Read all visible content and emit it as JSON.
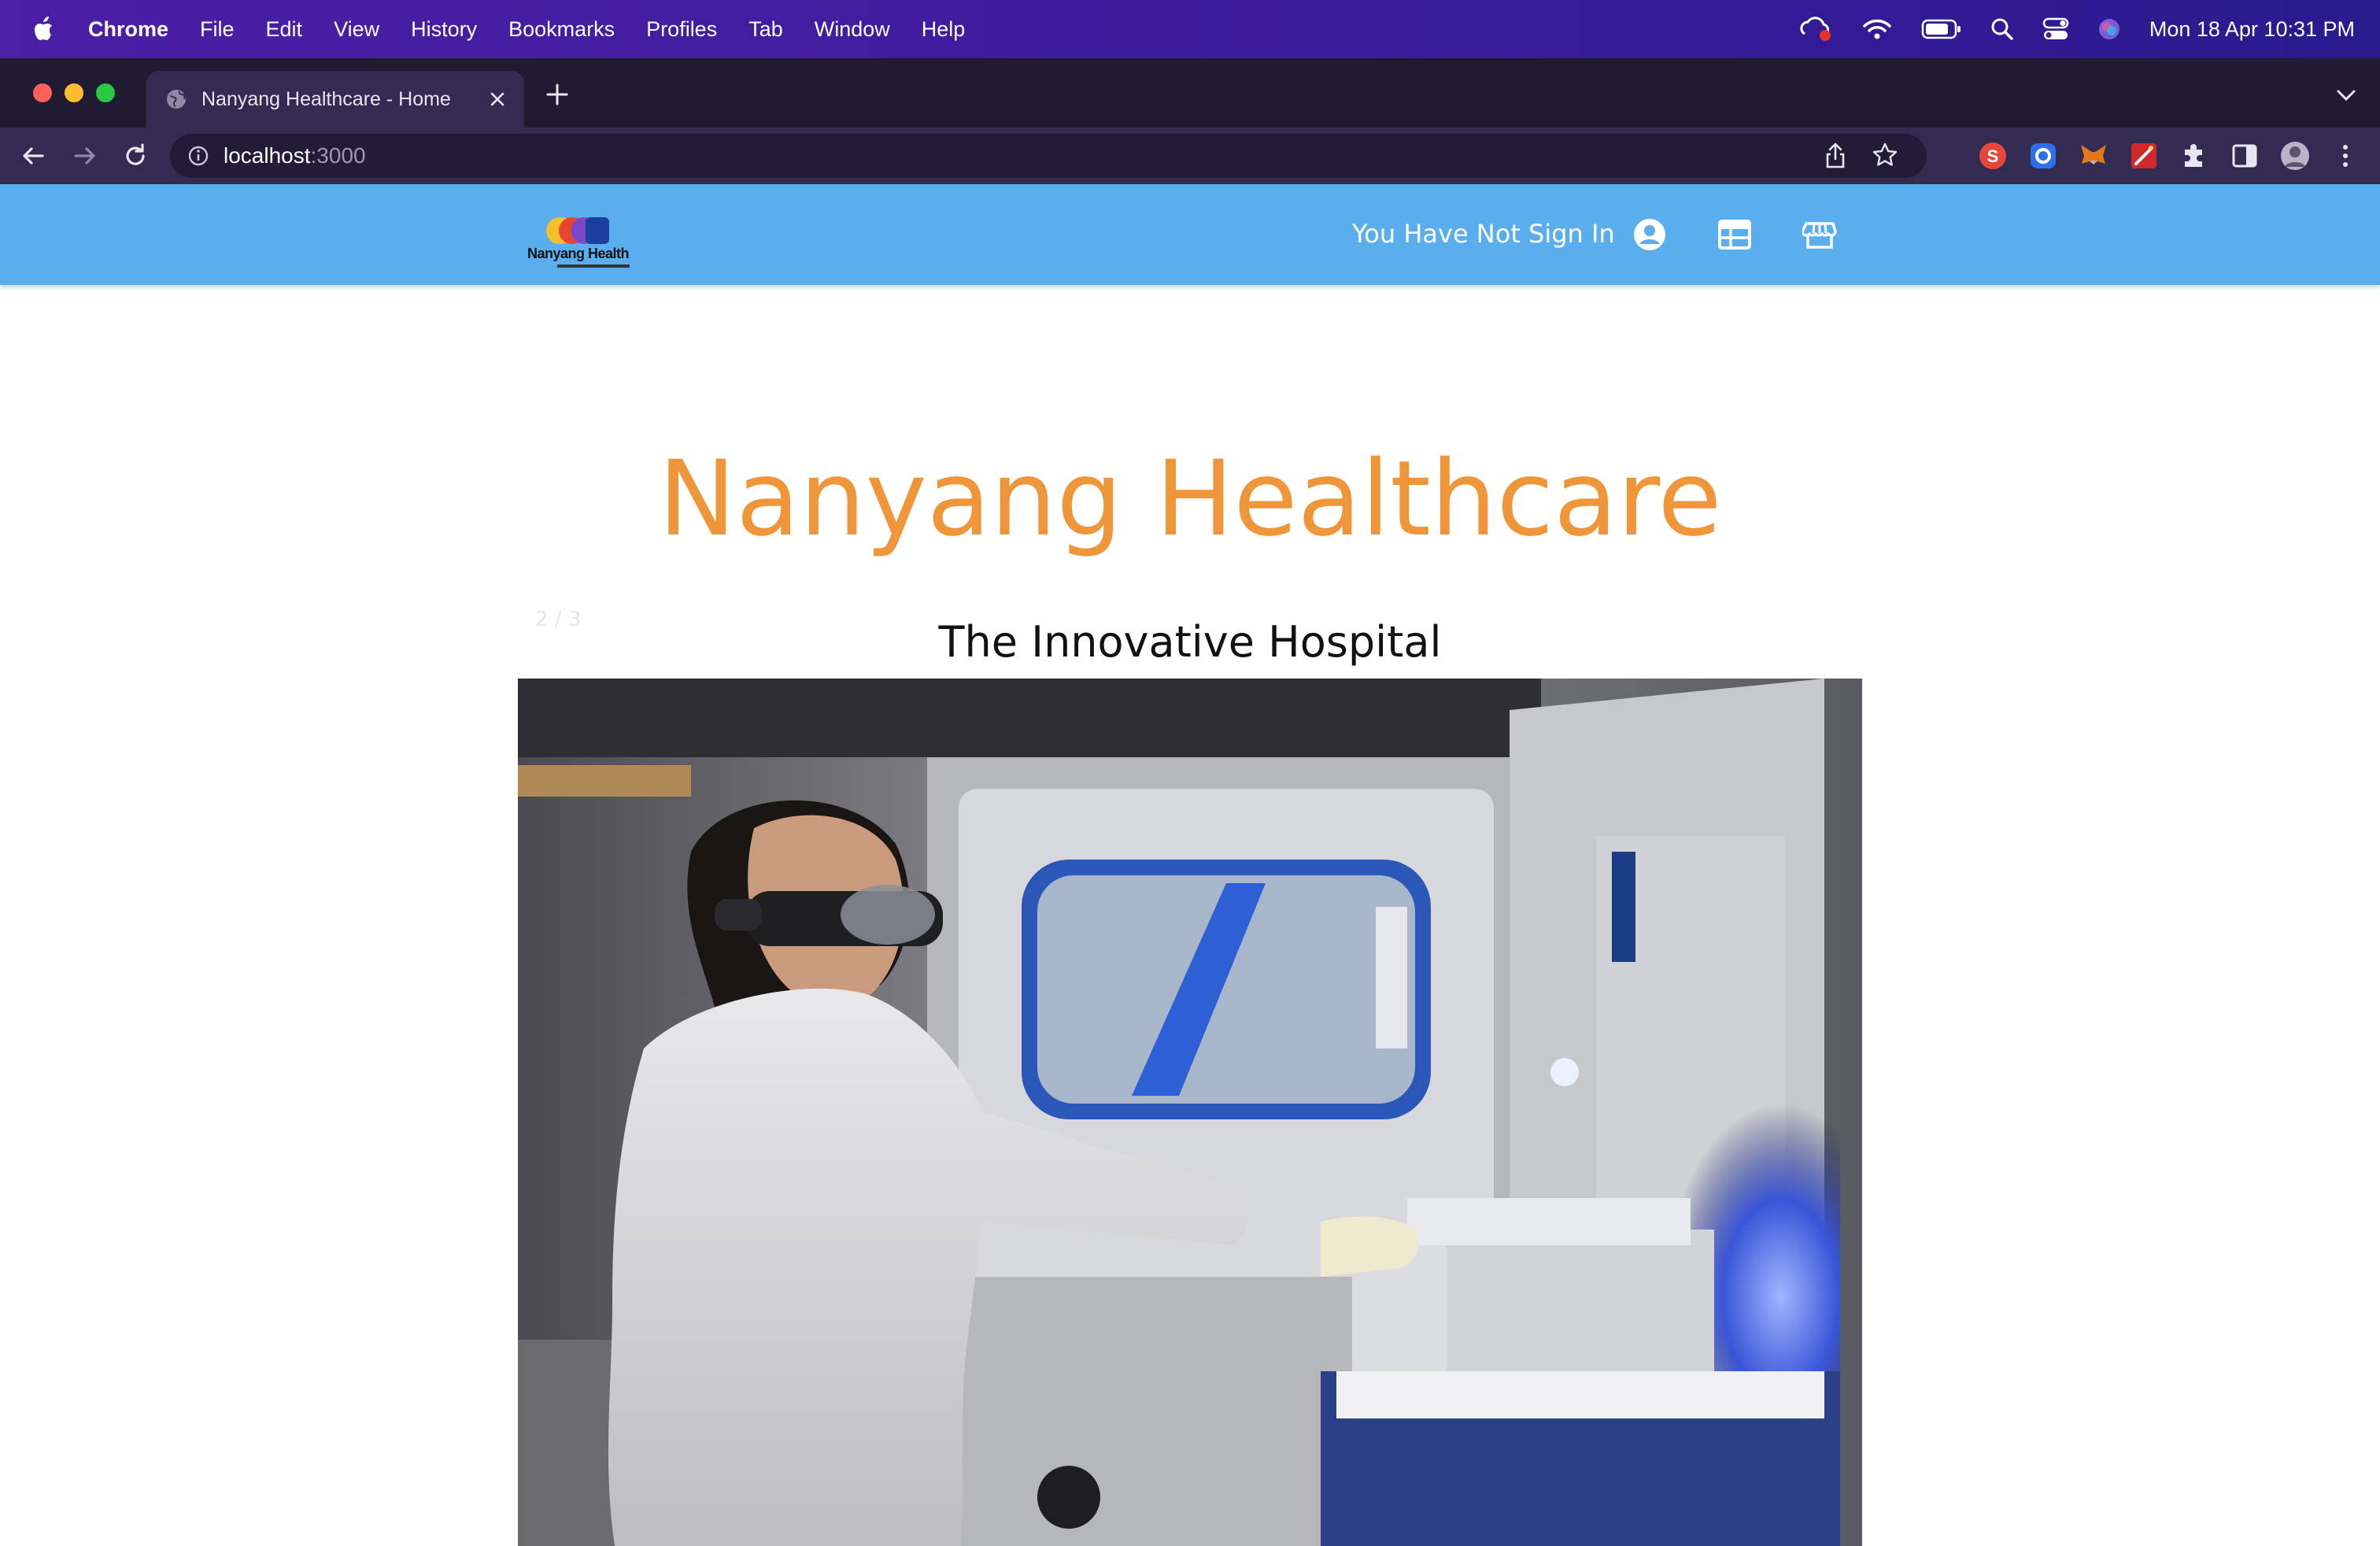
{
  "menubar": {
    "app_name": "Chrome",
    "items": [
      "File",
      "Edit",
      "View",
      "History",
      "Bookmarks",
      "Profiles",
      "Tab",
      "Window",
      "Help"
    ],
    "clock": "Mon 18 Apr  10:31 PM"
  },
  "browser": {
    "tab_title": "Nanyang Healthcare - Home",
    "url_host": "localhost",
    "url_port": ":3000"
  },
  "navbar": {
    "logo_text": "Nanyang Health",
    "signin_status": "You Have Not Sign In",
    "icons": [
      "account-circle-icon",
      "table-icon",
      "store-icon"
    ]
  },
  "hero": {
    "title": "Nanyang Healthcare",
    "slide_index": "2 / 3",
    "slide_caption": "The Innovative Hospital"
  },
  "colors": {
    "navbar_bg": "#5aaeed",
    "title_orange": "#f0963a",
    "menubar_purple": "#4b1fa6"
  }
}
